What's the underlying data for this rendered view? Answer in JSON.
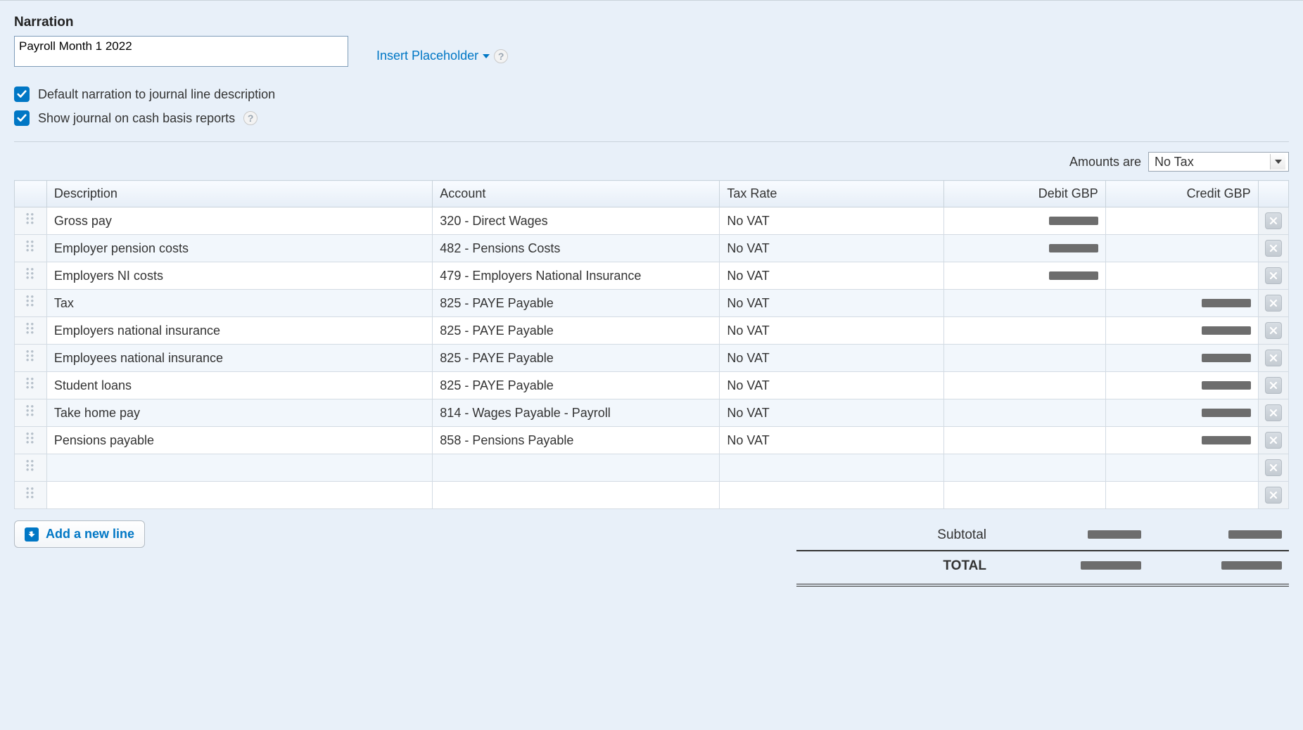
{
  "narration": {
    "label": "Narration",
    "value": "Payroll Month 1 2022",
    "insert_placeholder_label": "Insert Placeholder"
  },
  "options": {
    "default_narration_label": "Default narration to journal line description",
    "default_narration_checked": true,
    "show_cash_basis_label": "Show journal on cash basis reports",
    "show_cash_basis_checked": true
  },
  "amounts": {
    "label": "Amounts are",
    "selected": "No Tax"
  },
  "columns": {
    "description": "Description",
    "account": "Account",
    "tax_rate": "Tax Rate",
    "debit": "Debit GBP",
    "credit": "Credit GBP"
  },
  "lines": [
    {
      "description": "Gross pay",
      "account": "320 - Direct Wages",
      "tax_rate": "No VAT",
      "debit_redacted": true,
      "credit_redacted": false
    },
    {
      "description": "Employer pension costs",
      "account": "482 - Pensions Costs",
      "tax_rate": "No VAT",
      "debit_redacted": true,
      "credit_redacted": false
    },
    {
      "description": "Employers NI costs",
      "account": "479 - Employers National Insurance",
      "tax_rate": "No VAT",
      "debit_redacted": true,
      "credit_redacted": false
    },
    {
      "description": "Tax",
      "account": "825 - PAYE Payable",
      "tax_rate": "No VAT",
      "debit_redacted": false,
      "credit_redacted": true
    },
    {
      "description": "Employers national insurance",
      "account": "825 - PAYE Payable",
      "tax_rate": "No VAT",
      "debit_redacted": false,
      "credit_redacted": true
    },
    {
      "description": "Employees national insurance",
      "account": "825 - PAYE Payable",
      "tax_rate": "No VAT",
      "debit_redacted": false,
      "credit_redacted": true
    },
    {
      "description": "Student loans",
      "account": "825 - PAYE Payable",
      "tax_rate": "No VAT",
      "debit_redacted": false,
      "credit_redacted": true
    },
    {
      "description": "Take home pay",
      "account": "814 - Wages Payable - Payroll",
      "tax_rate": "No VAT",
      "debit_redacted": false,
      "credit_redacted": true
    },
    {
      "description": "Pensions payable",
      "account": "858 - Pensions Payable",
      "tax_rate": "No VAT",
      "debit_redacted": false,
      "credit_redacted": true
    },
    {
      "description": "",
      "account": "",
      "tax_rate": "",
      "debit_redacted": false,
      "credit_redacted": false
    },
    {
      "description": "",
      "account": "",
      "tax_rate": "",
      "debit_redacted": false,
      "credit_redacted": false
    }
  ],
  "footer": {
    "add_line_label": "Add a new line",
    "subtotal_label": "Subtotal",
    "total_label": "TOTAL"
  }
}
